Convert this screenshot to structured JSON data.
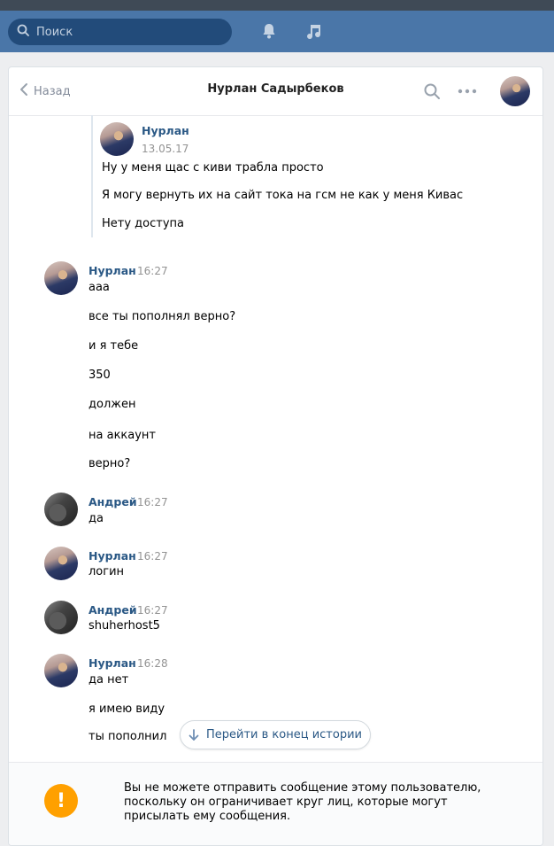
{
  "topbar": {
    "search_placeholder": "Поиск",
    "icons": [
      "search-icon",
      "bell-icon",
      "music-icon"
    ]
  },
  "header": {
    "back_label": "Назад",
    "title": "Нурлан Садырбеков",
    "icons": [
      "search-icon",
      "more-icon"
    ]
  },
  "forwarded": {
    "author": "Нурлан",
    "date": "13.05.17",
    "lines": [
      "Ну у меня щас с киви трабла просто",
      "Я могу вернуть их на сайт тока на гсм не как у меня Кивас",
      "Нету доступа"
    ]
  },
  "messages": [
    {
      "author": "Нурлан",
      "time": "16:27",
      "lines": [
        "ааа",
        "все ты пополнял верно?",
        "и я тебе",
        "350",
        "должен",
        "на аккаунт",
        "верно?"
      ]
    },
    {
      "author": "Андрей",
      "time": "16:27",
      "lines": [
        "да"
      ]
    },
    {
      "author": "Нурлан",
      "time": "16:27",
      "lines": [
        "логин"
      ]
    },
    {
      "author": "Андрей",
      "time": "16:27",
      "lines": [
        "shuherhost5"
      ]
    },
    {
      "author": "Нурлан",
      "time": "16:28",
      "lines": [
        "да нет",
        "я имею виду",
        "ты пополнил"
      ]
    }
  ],
  "jump_button": {
    "label": "Перейти в конец истории",
    "icon": "arrow-down-icon"
  },
  "footer": {
    "icon": "warning-icon",
    "icon_glyph": "!",
    "notice": "Вы не можете отправить сообщение этому пользователю, поскольку он ограничивает круг лиц, которые могут присылать ему сообщения."
  },
  "colors": {
    "topbar": "#4a76a8",
    "link": "#2a5885",
    "warning": "#ffa000",
    "background": "#edeef0"
  }
}
